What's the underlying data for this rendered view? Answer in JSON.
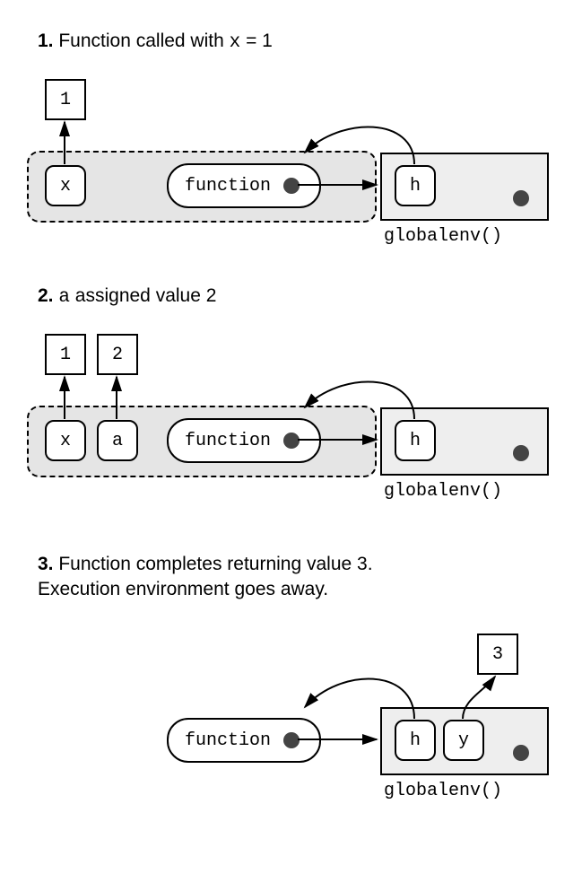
{
  "step1": {
    "caption_num": "1.",
    "caption_text1": " Function called with ",
    "caption_var": "x",
    "caption_text2": " = 1",
    "val_x": "1",
    "var_x": "x",
    "func_label": "function",
    "var_h": "h",
    "env_label": "globalenv()"
  },
  "step2": {
    "caption_num": "2.",
    "caption_var": "a",
    "caption_text": " assigned value 2",
    "val_x": "1",
    "val_a": "2",
    "var_x": "x",
    "var_a": "a",
    "func_label": "function",
    "var_h": "h",
    "env_label": "globalenv()"
  },
  "step3": {
    "caption_num": "3.",
    "caption_text1": " Function completes returning value 3.",
    "caption_text2": "Execution environment goes away.",
    "func_label": "function",
    "var_h": "h",
    "var_y": "y",
    "val_y": "3",
    "env_label": "globalenv()"
  }
}
